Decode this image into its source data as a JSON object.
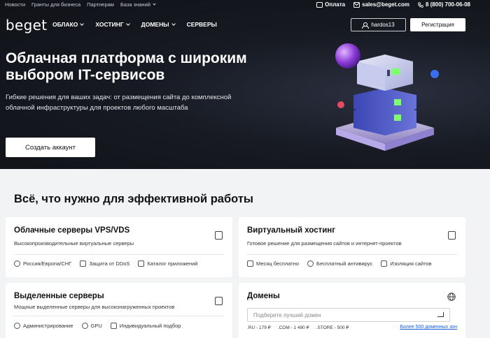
{
  "topbar": {
    "links": [
      "Новости",
      "Гранты для бизнеса",
      "Партнерам",
      "База знаний"
    ],
    "payment": "Оплата",
    "email": "sales@beget.com",
    "phone": "8 (800) 700-06-08"
  },
  "nav": {
    "logo": "beget",
    "menu": [
      "ОБЛАКО",
      "ХОСТИНГ",
      "ДОМЕНЫ",
      "СЕРВЕРЫ"
    ],
    "user": "hardos13",
    "register": "Регистрация"
  },
  "hero": {
    "title": "Облачная платформа с широким выбором IT-сервисов",
    "subtitle": "Гибкие решения для ваших задач: от размещения сайта до комплексной облачной инфраструктуры для проектов любого масштаба",
    "cta": "Создать аккаунт"
  },
  "main": {
    "title": "Всё, что нужно для эффективной работы",
    "cards": [
      {
        "title": "Облачные серверы VPS/VDS",
        "desc": "Высокопроизводительные виртуальные серверы",
        "features": [
          "Россия/Европа/СНГ",
          "Защита от DDoS",
          "Каталог приложений"
        ],
        "icon": "cloud-server-icon"
      },
      {
        "title": "Виртуальный хостинг",
        "desc": "Готовое решение для размещения сайтов и интернет-проектов",
        "features": [
          "Месяц бесплатно",
          "Бесплатный антивирус",
          "Изоляция сайтов"
        ],
        "icon": "hosting-icon"
      },
      {
        "title": "Выделенные серверы",
        "desc": "Мощные выделенные серверы для высоконагруженных проектов",
        "features": [
          "Администрирование",
          "GPU",
          "Индивидуальный подбор"
        ],
        "icon": "dedicated-server-icon"
      },
      {
        "title": "Домены",
        "placeholder": "Подберите лучший домен",
        "zones": [
          ".RU - 179 ₽",
          ".COM - 1 490 ₽",
          ".STORE - 500 ₽"
        ],
        "more": "Более 500 доменных зон",
        "icon": "globe-icon"
      }
    ]
  }
}
